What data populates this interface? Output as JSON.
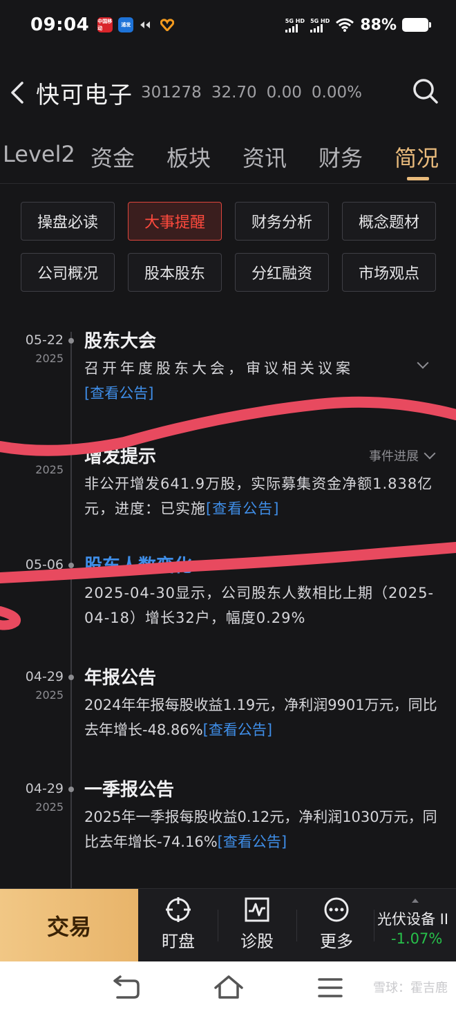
{
  "status_bar": {
    "time": "09:04",
    "app_icons": [
      "中国移动",
      "浦发",
      "share-icon",
      "heart-icon"
    ],
    "sim1": "5G HD",
    "sim2": "5G HD",
    "battery": "88%"
  },
  "header": {
    "stock_name": "快可电子",
    "code": "301278",
    "price": "32.70",
    "change": "0.00",
    "change_pct": "0.00%"
  },
  "tabs": [
    {
      "label": "Level2"
    },
    {
      "label": "资金"
    },
    {
      "label": "板块"
    },
    {
      "label": "资讯"
    },
    {
      "label": "财务"
    },
    {
      "label": "简况"
    }
  ],
  "buttons": [
    {
      "label": "操盘必读"
    },
    {
      "label": "大事提醒"
    },
    {
      "label": "财务分析"
    },
    {
      "label": "概念题材"
    },
    {
      "label": "公司概况"
    },
    {
      "label": "股本股东"
    },
    {
      "label": "分红融资"
    },
    {
      "label": "市场观点"
    }
  ],
  "events": [
    {
      "date": "05-22",
      "year": "2025",
      "title": "股东大会",
      "body": "召开年度股东大会，审议相关议案",
      "link": "[查看公告]"
    },
    {
      "date": "",
      "year": "2025",
      "title": "增发提示",
      "progress": "事件进展",
      "body": "非公开增发641.9万股，实际募集资金净额1.838亿元，进度：已实施",
      "link": "[查看公告]"
    },
    {
      "date": "05-06",
      "year": "",
      "title": "股东人数变化",
      "body": "2025-04-30显示，公司股东人数相比上期（2025-04-18）增长32户，幅度0.29%"
    },
    {
      "date": "04-29",
      "year": "2025",
      "title": "年报公告",
      "body": "2024年年报每股收益1.19元，净利润9901万元，同比去年增长-48.86%",
      "link": "[查看公告]"
    },
    {
      "date": "04-29",
      "year": "2025",
      "title": "一季报公告",
      "body": "2025年一季报每股收益0.12元，净利润1030万元，同比去年增长-74.16%",
      "link": "[查看公告]"
    }
  ],
  "bottom_bar": {
    "trade": "交易",
    "items": [
      {
        "label": "盯盘",
        "icon": "crosshair-icon"
      },
      {
        "label": "诊股",
        "icon": "pulse-chart-icon"
      },
      {
        "label": "更多",
        "icon": "more-dots-icon"
      }
    ],
    "sector_name": "光伏设备 II",
    "sector_change": "-1.07%"
  },
  "watermark": "雪球：霍吉鹿",
  "colors": {
    "accent": "#e9bb7c",
    "active_red": "#ff4a3d",
    "link_blue": "#3f8ee8",
    "down_green": "#27c04a",
    "scribble": "#e84a5f"
  }
}
